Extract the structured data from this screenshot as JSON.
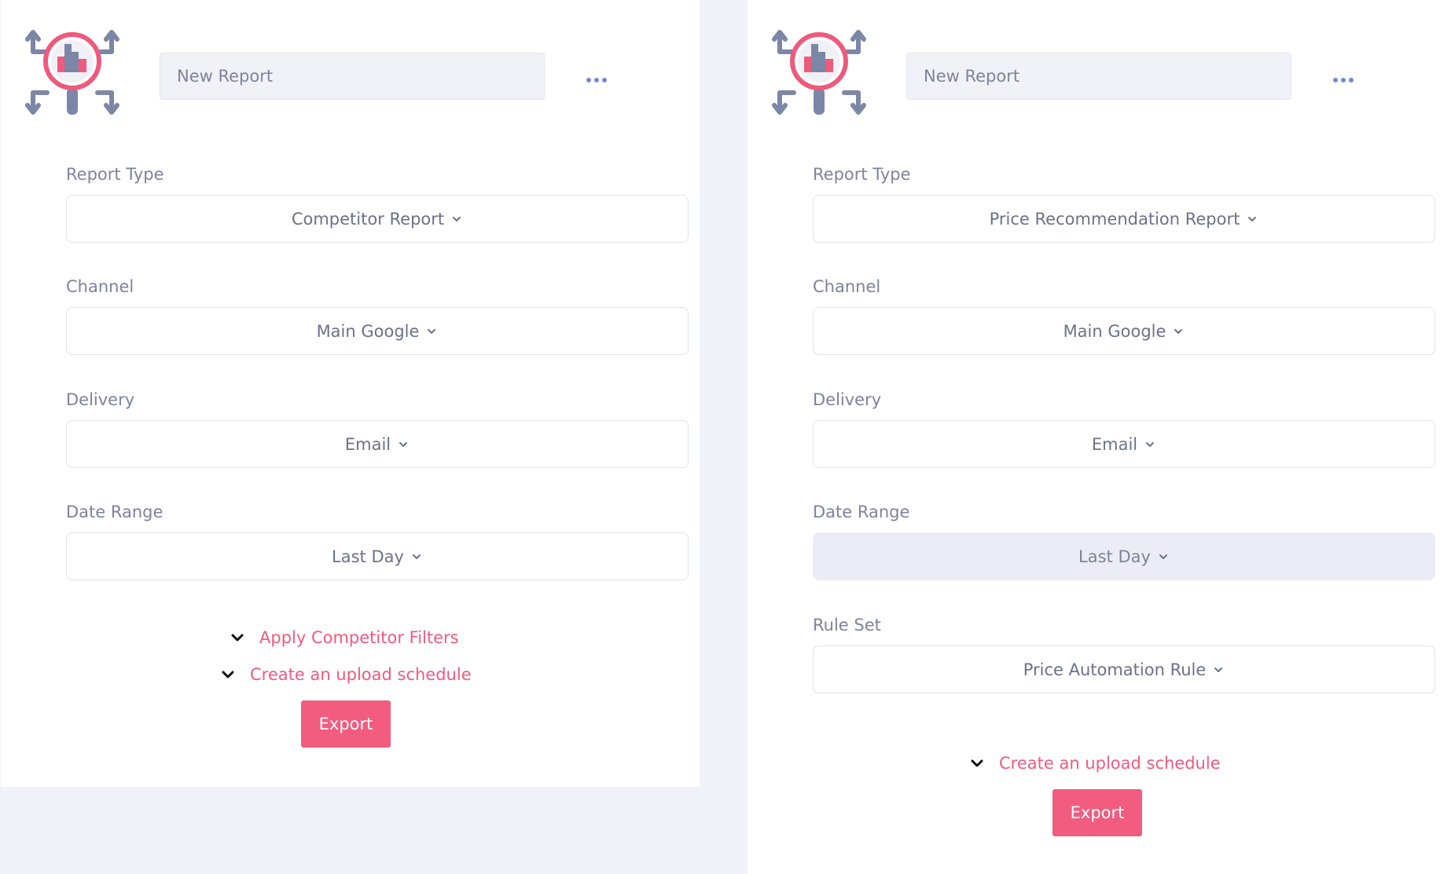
{
  "left": {
    "name_placeholder": "New Report",
    "fields": [
      {
        "label": "Report Type",
        "value": "Competitor Report"
      },
      {
        "label": "Channel",
        "value": "Main Google"
      },
      {
        "label": "Delivery",
        "value": "Email"
      },
      {
        "label": "Date Range",
        "value": "Last Day"
      }
    ],
    "competitor_filters_link": "Apply Competitor Filters",
    "upload_schedule_link": "Create an upload schedule",
    "export_label": "Export"
  },
  "right": {
    "name_placeholder": "New Report",
    "fields": [
      {
        "label": "Report Type",
        "value": "Price Recommendation Report"
      },
      {
        "label": "Channel",
        "value": "Main Google"
      },
      {
        "label": "Delivery",
        "value": "Email"
      },
      {
        "label": "Date Range",
        "value": "Last Day",
        "disabled": true
      },
      {
        "label": "Rule Set",
        "value": "Price Automation Rule"
      }
    ],
    "upload_schedule_link": "Create an upload schedule",
    "export_label": "Export"
  },
  "colors": {
    "accent": "#f25c7f",
    "logo_pink": "#ee5a7c",
    "logo_slate": "#7c86a6",
    "label_text": "#7d849b",
    "page_bg": "#f1f2f7"
  },
  "icons": [
    "report-logo-icon",
    "more-dots-icon",
    "chevron-down-icon"
  ]
}
